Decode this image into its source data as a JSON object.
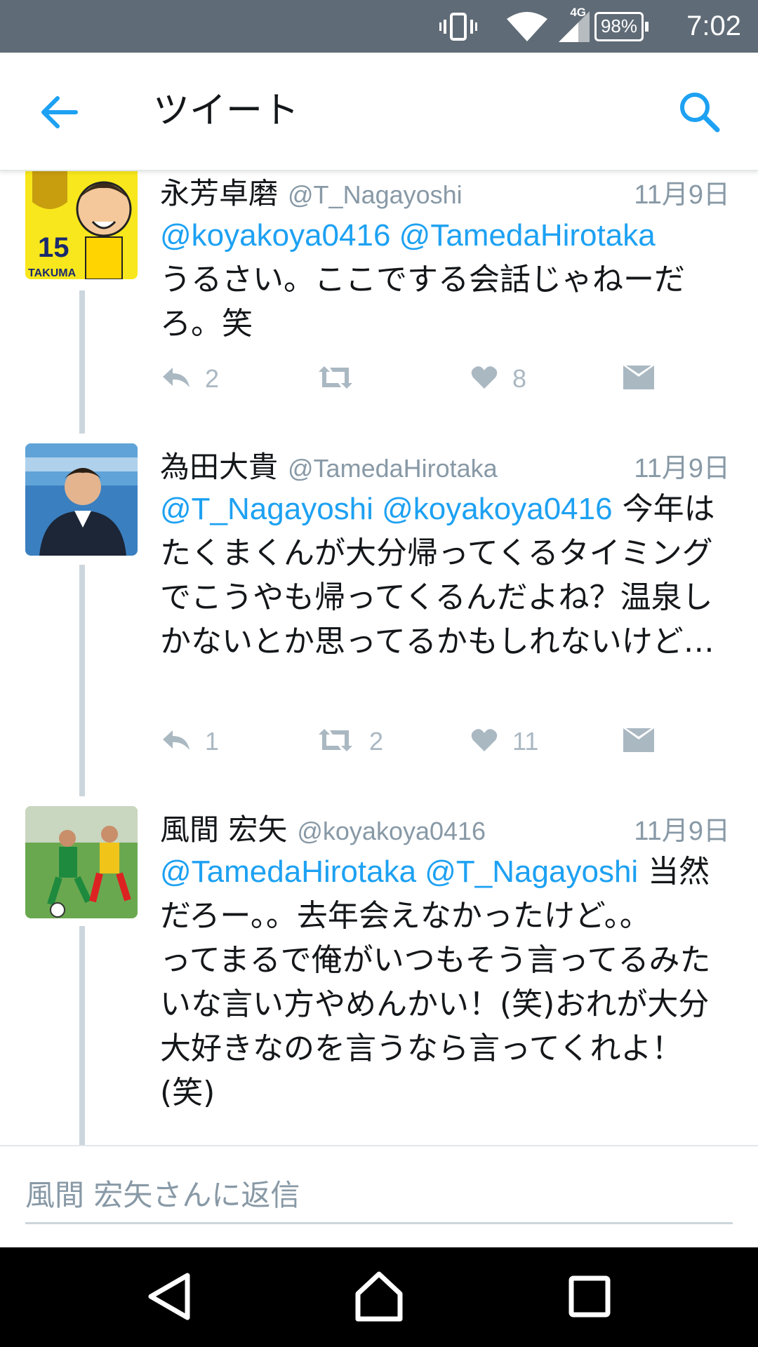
{
  "status_bar": {
    "time": "7:02",
    "battery": "98%",
    "network": "4G",
    "icons": [
      "vibrate-icon",
      "wifi-icon",
      "signal-icon",
      "battery-icon"
    ]
  },
  "app_bar": {
    "title": "ツイート",
    "back_icon": "arrow-left-icon",
    "search_icon": "search-icon",
    "accent": "#1da1f2"
  },
  "tweets": [
    {
      "name": "永芳卓磨",
      "handle": "@T_Nagayoshi",
      "date": "11月9日",
      "mentions": "@koyakoya0416 @TamedaHirotaka",
      "text": "うるさい。ここでする会話じゃねーだろ。笑",
      "avatar_text": "15",
      "avatar_caption": "TAKUMA",
      "replies": "2",
      "retweets": "",
      "likes": "8"
    },
    {
      "name": "為田大貴",
      "handle": "@TamedaHirotaka",
      "date": "11月9日",
      "mentions": "@T_Nagayoshi @koyakoya0416",
      "text": " 今年はたくまくんが大分帰ってくるタイミングでこうやも帰ってくるんだよね？温泉しかないとか思ってるかもしれないけど…",
      "replies": "1",
      "retweets": "2",
      "likes": "11"
    },
    {
      "name": "風間 宏矢",
      "handle": "@koyakoya0416",
      "date": "11月9日",
      "mentions": "@TamedaHirotaka @T_Nagayoshi",
      "text": " 当然だろー。。去年会えなかったけど。。\nってまるで俺がいつもそう言ってるみたいな言い方やめんかい！(笑)おれが大分大好きなのを言うなら言ってくれよ！(笑)"
    }
  ],
  "reply_bar": {
    "placeholder": "風間 宏矢さんに返信"
  },
  "nav_bar": {
    "icons": [
      "back-triangle-icon",
      "home-icon",
      "recents-icon"
    ]
  }
}
